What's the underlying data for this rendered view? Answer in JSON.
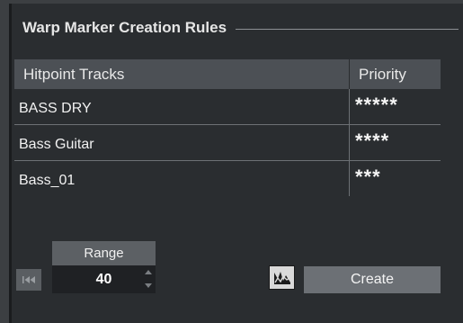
{
  "panel": {
    "title": "Warp Marker Creation Rules"
  },
  "table": {
    "columns": [
      "Hitpoint Tracks",
      "Priority"
    ],
    "rows": [
      {
        "track": "BASS DRY",
        "priority": "*****"
      },
      {
        "track": "Bass Guitar",
        "priority": "****"
      },
      {
        "track": "Bass_01",
        "priority": "***"
      }
    ]
  },
  "range": {
    "label": "Range",
    "value": "40"
  },
  "buttons": {
    "create_label": "Create",
    "first_icon": "skip-to-start-icon",
    "warp_icon": "warp-marker-icon"
  }
}
